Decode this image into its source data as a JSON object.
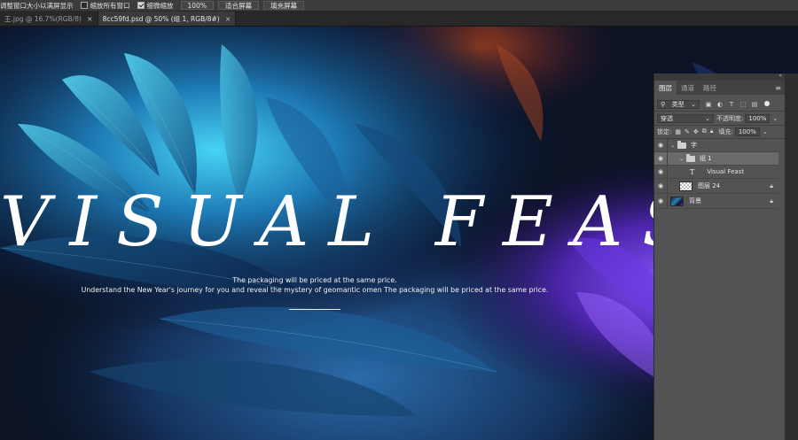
{
  "options_bar": {
    "resize_windows_label": "调整窗口大小以满屏显示",
    "zoom_all_label": "缩放所有窗口",
    "zoom_all_checked": false,
    "scrubby_zoom_label": "细微缩放",
    "scrubby_zoom_checked": true,
    "zoom_value": "100%",
    "fit_screen_label": "适合屏幕",
    "fill_screen_label": "填充屏幕"
  },
  "document_tabs": [
    {
      "title": "王.jpg @ 16.7%(RGB/8)",
      "close": "×",
      "active": false
    },
    {
      "title": "8cc59fd.psd @ 50% (组 1, RGB/8#)",
      "close": "×",
      "active": true
    }
  ],
  "canvas": {
    "title": "VISUAL FEAST",
    "subtitle_line1": "The packaging will be priced at the same price.",
    "subtitle_line2": "Understand the New Year's journey for you and reveal the mystery of geomantic omen    The packaging will be priced at the same price."
  },
  "layers_panel": {
    "collapse_arrows": "«",
    "tabs": [
      {
        "label": "图层",
        "active": true
      },
      {
        "label": "通道",
        "active": false
      },
      {
        "label": "路径",
        "active": false
      }
    ],
    "menu_icon": "≡",
    "filter_kind": "类型",
    "blend_mode": "穿透",
    "opacity_label": "不透明度:",
    "opacity_value": "100%",
    "lock_label": "锁定:",
    "fill_label": "填充:",
    "fill_value": "100%",
    "dropdown_arrow": "⌄",
    "layers": [
      {
        "name": "字",
        "kind": "group",
        "indent": 0,
        "expanded": true,
        "highlight": false
      },
      {
        "name": "组 1",
        "kind": "group",
        "indent": 1,
        "expanded": true,
        "highlight": true
      },
      {
        "name": "Visual Feast",
        "kind": "text",
        "indent": 2,
        "highlight": false,
        "type_glyph": "T"
      },
      {
        "name": "图层 24",
        "kind": "pixel",
        "indent": 1,
        "highlight": false,
        "locked": true
      },
      {
        "name": "背景",
        "kind": "image",
        "indent": 0,
        "highlight": false,
        "locked": true
      }
    ]
  },
  "colors": {
    "panel_bg": "#535353",
    "options_bar_bg": "#3c3c3c",
    "canvas_bg": "#0b1324",
    "cyan_feather": "#2fb9e6",
    "purple_glow": "#7b3cf0"
  }
}
